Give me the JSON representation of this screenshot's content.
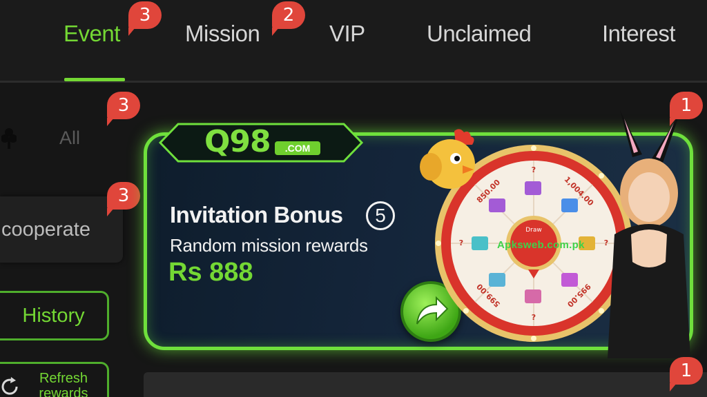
{
  "tabs": [
    {
      "label": "Event",
      "badge": "3",
      "active": true
    },
    {
      "label": "Mission",
      "badge": "2",
      "active": false
    },
    {
      "label": "VIP",
      "active": false
    },
    {
      "label": "Unclaimed",
      "active": false
    },
    {
      "label": "Interest",
      "active": false
    }
  ],
  "sidebar": {
    "all_label": "All",
    "all_badge": "3",
    "cooperate_label": "cooperate",
    "cooperate_badge": "3",
    "history_label": "History",
    "refresh_label": "Refresh rewards"
  },
  "banner": {
    "badge": "1",
    "logo_main": "Q98",
    "logo_com": ".COM",
    "title": "Invitation Bonus",
    "count": "5",
    "subtitle": "Random mission rewards",
    "amount": "Rs 888",
    "wheel_labels": [
      "850.00",
      "?",
      "1,004.00",
      "?",
      "995.00",
      "?",
      "599.00",
      "?"
    ],
    "wheel_center": "Draw"
  },
  "watermark": "Apksweb.com.pk",
  "second_banner_badge": "1",
  "colors": {
    "accent": "#74d834",
    "badge": "#e0463b",
    "background": "#161616",
    "banner_glow": "#6fe03c"
  }
}
